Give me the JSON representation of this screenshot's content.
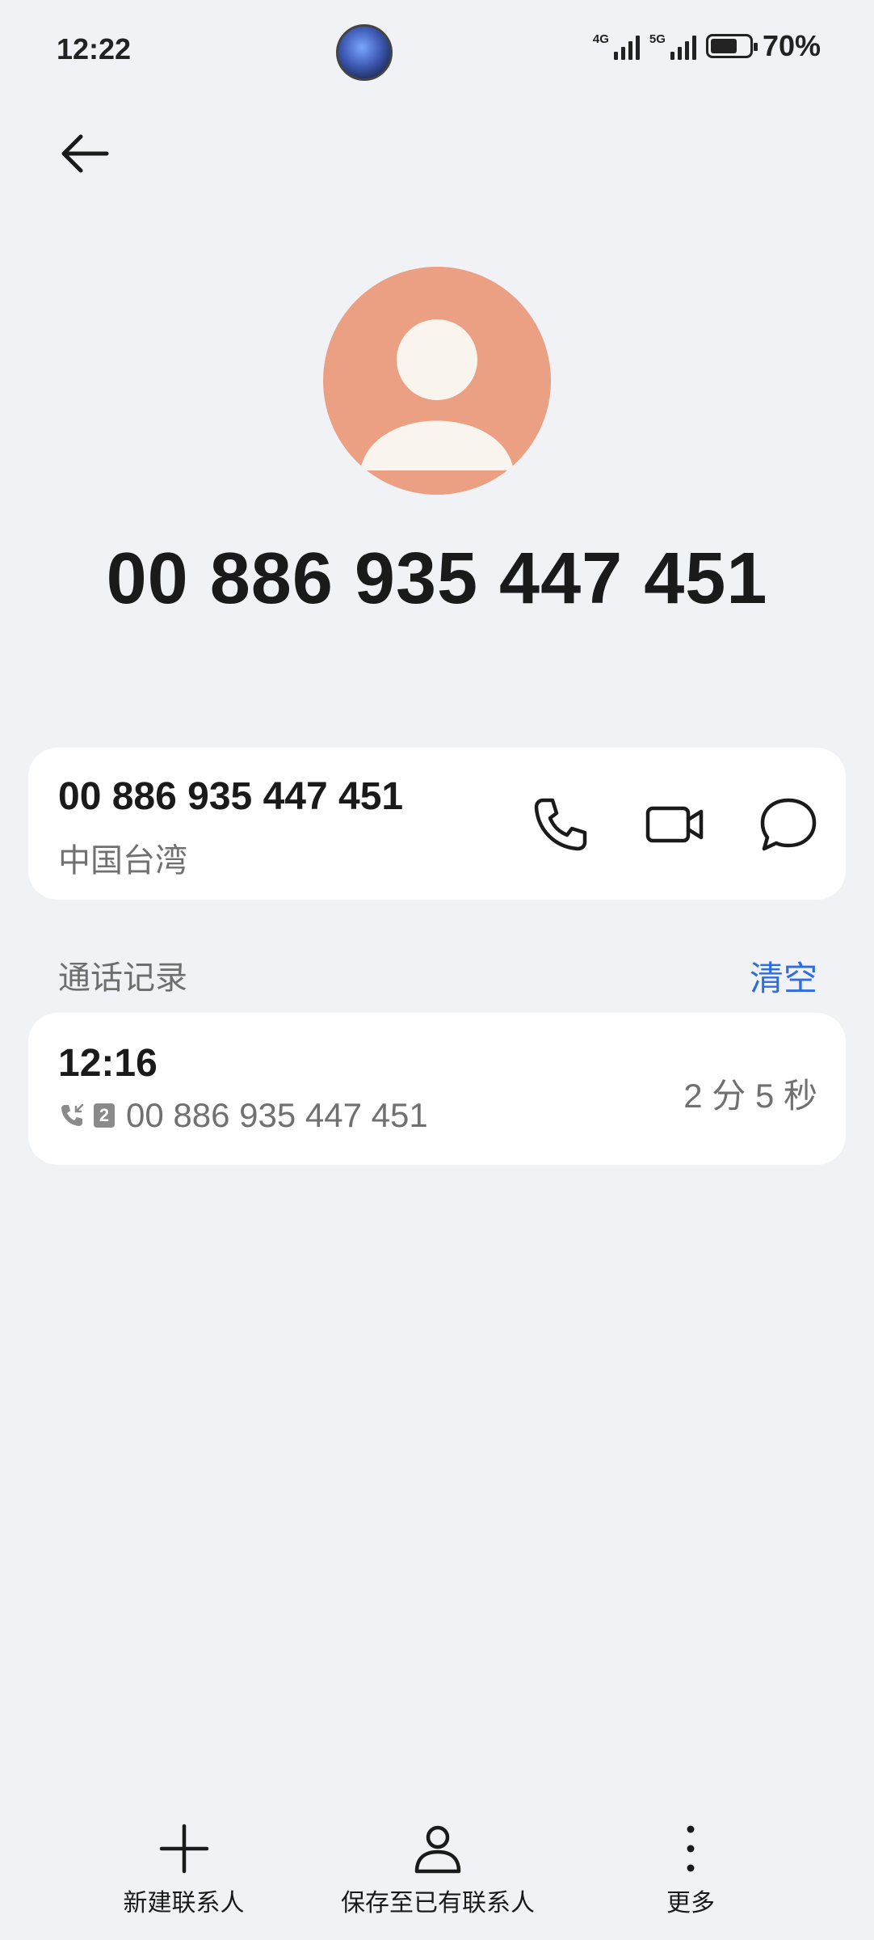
{
  "status_bar": {
    "time": "12:22",
    "network_1": "4G",
    "network_2": "5G",
    "battery_text": "70%",
    "battery_level": 0.7
  },
  "contact": {
    "headline_number": "00 886 935 447 451"
  },
  "number_card": {
    "number": "00 886 935 447 451",
    "location": "中国台湾"
  },
  "call_log": {
    "title": "通话记录",
    "clear_label": "清空",
    "entries": [
      {
        "time": "12:16",
        "sim": "2",
        "number": "00 886 935 447 451",
        "duration": "2 分 5 秒"
      }
    ]
  },
  "bottom_bar": {
    "new_contact": "新建联系人",
    "save_existing": "保存至已有联系人",
    "more": "更多"
  },
  "colors": {
    "accent": "#2d6ce3",
    "avatar_bg": "#eba083",
    "page_bg": "#f1f2f6"
  }
}
